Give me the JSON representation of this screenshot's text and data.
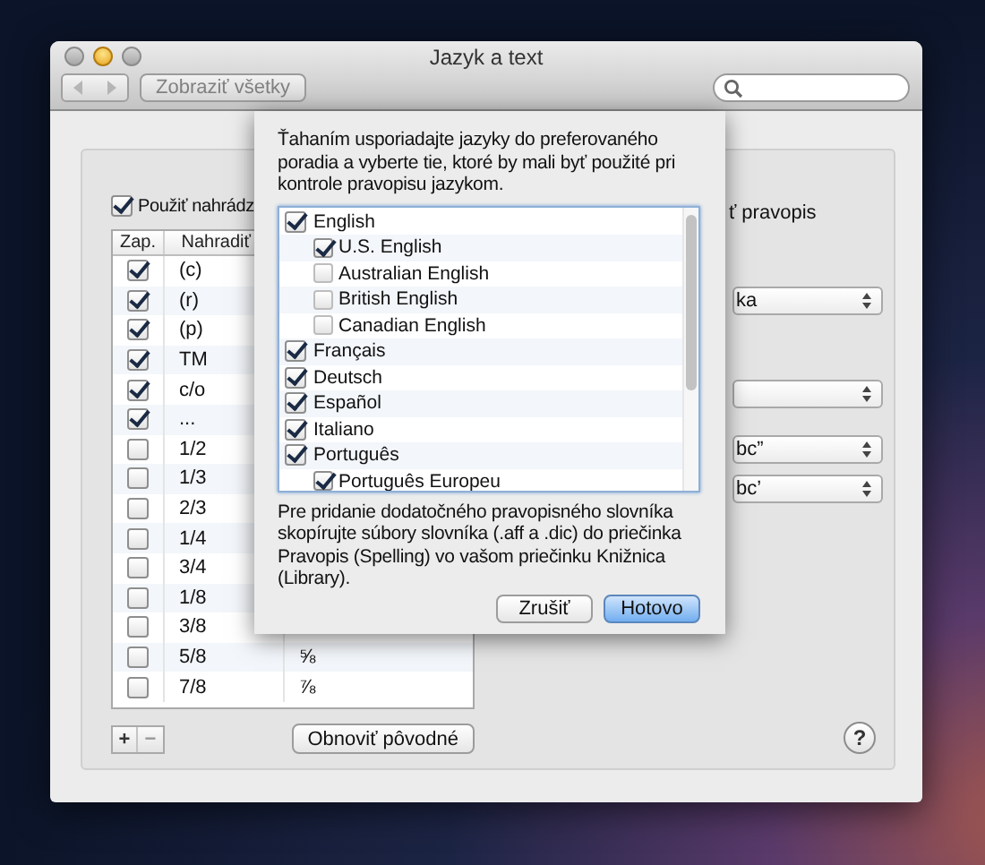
{
  "window": {
    "title": "Jazyk a text"
  },
  "toolbar": {
    "show_all_button": "Zobraziť všetky"
  },
  "substitutions": {
    "enabled_checkbox": {
      "label": "Použiť nahrádz",
      "checked": true
    },
    "columns": [
      "Zap.",
      "Nahradiť"
    ],
    "rows": [
      {
        "checked": true,
        "replace": "(c)"
      },
      {
        "checked": true,
        "replace": "(r)"
      },
      {
        "checked": true,
        "replace": "(p)"
      },
      {
        "checked": true,
        "replace": "TM"
      },
      {
        "checked": true,
        "replace": "c/o"
      },
      {
        "checked": true,
        "replace": "..."
      },
      {
        "checked": false,
        "replace": "1/2"
      },
      {
        "checked": false,
        "replace": "1/3"
      },
      {
        "checked": false,
        "replace": "2/3"
      },
      {
        "checked": false,
        "replace": "1/4"
      },
      {
        "checked": false,
        "replace": "3/4"
      },
      {
        "checked": false,
        "replace": "1/8"
      },
      {
        "checked": false,
        "replace": "3/8"
      },
      {
        "checked": false,
        "replace": "5/8",
        "with": "⅝"
      },
      {
        "checked": false,
        "replace": "7/8",
        "with": "⅞"
      }
    ],
    "add_button": "+",
    "remove_button": "−",
    "restore_button": "Obnoviť pôvodné"
  },
  "right_panel": {
    "label": "ť pravopis",
    "popups": [
      {
        "kind": "popup",
        "value": "ka"
      },
      {
        "kind": "popup"
      },
      {
        "kind": "popup",
        "value": "bc”"
      },
      {
        "kind": "popup",
        "value": "bc’"
      }
    ],
    "help_button": "?"
  },
  "sheet": {
    "instructions": "Ťahaním usporiadajte jazyky do preferovaného poradia a vyberte tie, ktoré by mali byť použité pri kontrole pravopisu jazykom.",
    "languages": [
      {
        "label": "English",
        "checked": true,
        "children": [
          {
            "label": "U.S. English",
            "checked": true
          },
          {
            "label": "Australian English",
            "checked": false
          },
          {
            "label": "British English",
            "checked": false
          },
          {
            "label": "Canadian English",
            "checked": false
          }
        ]
      },
      {
        "label": "Français",
        "checked": true
      },
      {
        "label": "Deutsch",
        "checked": true
      },
      {
        "label": "Español",
        "checked": true
      },
      {
        "label": "Italiano",
        "checked": true
      },
      {
        "label": "Português",
        "checked": true,
        "children": [
          {
            "label": "Português Europeu",
            "checked": true
          }
        ]
      }
    ],
    "note": "Pre pridanie dodatočného pravopisného slovníka skopírujte súbory slovníka (.aff a .dic) do priečinka Pravopis (Spelling) vo vašom priečinku Knižnica (Library).",
    "buttons": [
      {
        "label": "Zrušiť",
        "default": false
      },
      {
        "label": "Hotovo",
        "default": true
      }
    ]
  }
}
